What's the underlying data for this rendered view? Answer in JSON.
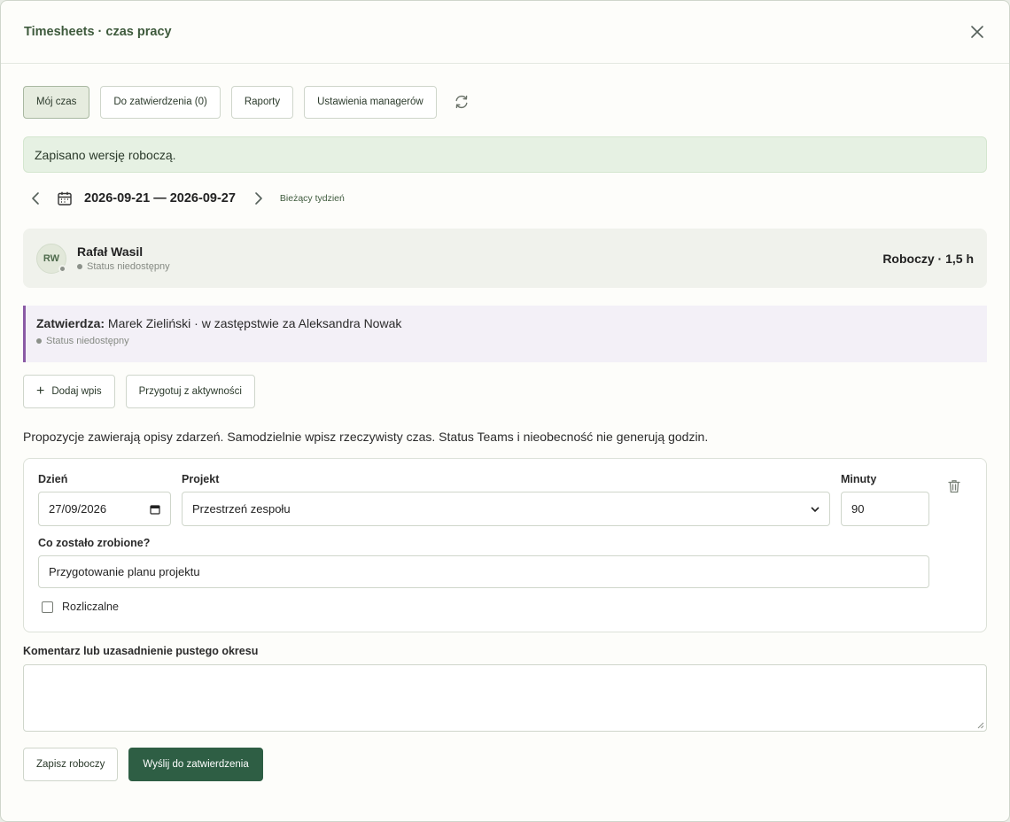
{
  "dialog": {
    "title": "Timesheets · czas pracy"
  },
  "tabs": [
    {
      "label": "Mój czas",
      "active": true
    },
    {
      "label": "Do zatwierdzenia (0)",
      "active": false
    },
    {
      "label": "Raporty",
      "active": false
    },
    {
      "label": "Ustawienia managerów",
      "active": false
    }
  ],
  "alert": {
    "text": "Zapisano wersję roboczą."
  },
  "week": {
    "range": "2026-09-21 — 2026-09-27",
    "current_label": "Bieżący tydzień"
  },
  "user": {
    "initials": "RW",
    "name": "Rafał Wasil",
    "status": "Status niedostępny",
    "summary": "Roboczy · 1,5 h"
  },
  "approver": {
    "label": "Zatwierdza:",
    "text": " Marek Zieliński · w zastępstwie za Aleksandra Nowak",
    "status": "Status niedostępny",
    "accent": "#8a5aa5"
  },
  "actions": {
    "add_entry": "Dodaj wpis",
    "prepare": "Przygotuj z aktywności"
  },
  "info": "Propozycje zawierają opisy zdarzeń. Samodzielnie wpisz rzeczywisty czas. Status Teams i nieobecność nie generują godzin.",
  "entry": {
    "day_label": "Dzień",
    "day_value": "27/09/2026",
    "project_label": "Projekt",
    "project_value": "Przestrzeń zespołu",
    "minutes_label": "Minuty",
    "minutes_value": "90",
    "done_label": "Co zostało zrobione?",
    "done_value": "Przygotowanie planu projektu",
    "billable_label": "Rozliczalne",
    "billable_checked": false
  },
  "comment": {
    "label": "Komentarz lub uzasadnienie pustego okresu",
    "value": ""
  },
  "footer": {
    "save_draft": "Zapisz roboczy",
    "submit": "Wyślij do zatwierdzenia"
  },
  "colors": {
    "primary": "#2e5e44",
    "alert_bg": "#e6f1e3",
    "title": "#3e5a3c"
  }
}
